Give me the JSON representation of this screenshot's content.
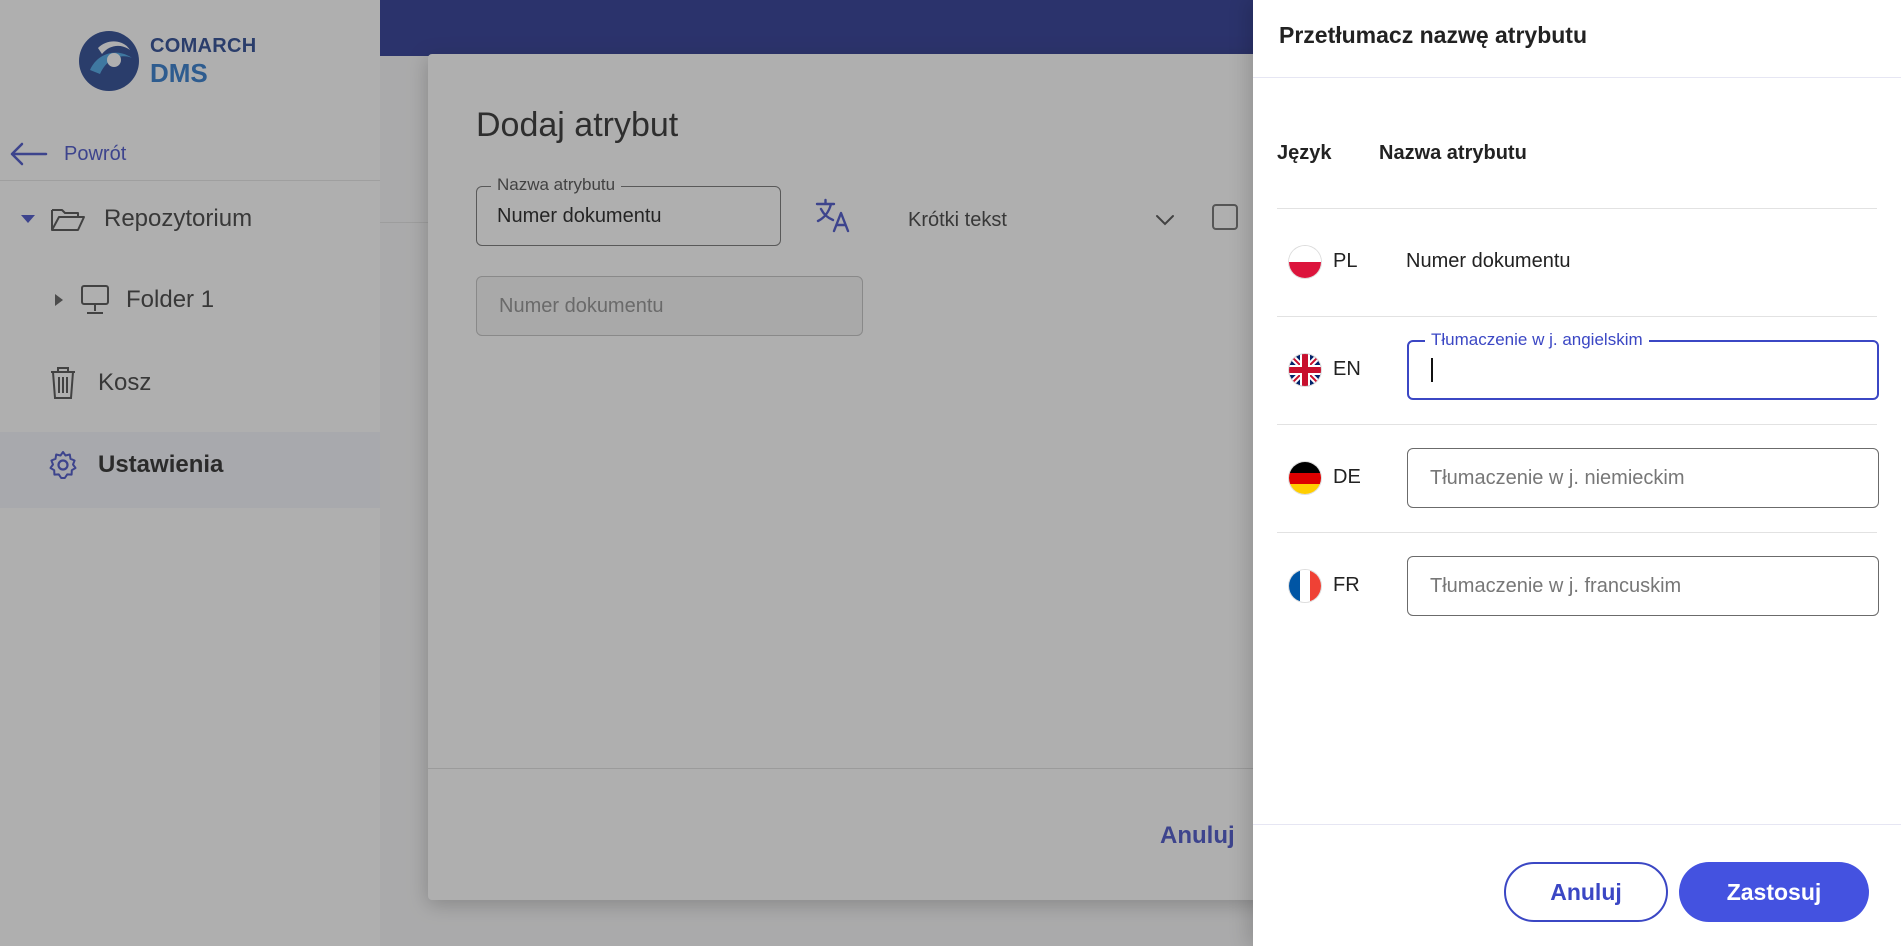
{
  "sidebar": {
    "logo": {
      "line1": "COMARCH",
      "line2": "DMS"
    },
    "back_label": "Powrót",
    "items": [
      {
        "label": "Repozytorium"
      },
      {
        "label": "Folder 1"
      },
      {
        "label": "Kosz"
      },
      {
        "label": "Ustawienia"
      }
    ]
  },
  "dialog": {
    "title": "Dodaj atrybut",
    "attr_name_label": "Nazwa atrybutu",
    "attr_name_value": "Numer dokumentu",
    "type_value": "Krótki tekst",
    "placeholder_value": "Numer dokumentu",
    "cancel_label": "Anuluj"
  },
  "panel": {
    "title": "Przetłumacz nazwę atrybutu",
    "col_language": "Język",
    "col_name": "Nazwa atrybutu",
    "rows": [
      {
        "code": "PL",
        "value": "Numer dokumentu"
      },
      {
        "code": "EN",
        "label": "Tłumaczenie w j. angielskim",
        "value": ""
      },
      {
        "code": "DE",
        "placeholder": "Tłumaczenie w j. niemieckim"
      },
      {
        "code": "FR",
        "placeholder": "Tłumaczenie w j. francuskim"
      }
    ],
    "cancel_label": "Anuluj",
    "apply_label": "Zastosuj"
  },
  "colors": {
    "accent": "#3b47c4",
    "topbar": "#1d2a8c",
    "apply_button": "#4452e0"
  }
}
